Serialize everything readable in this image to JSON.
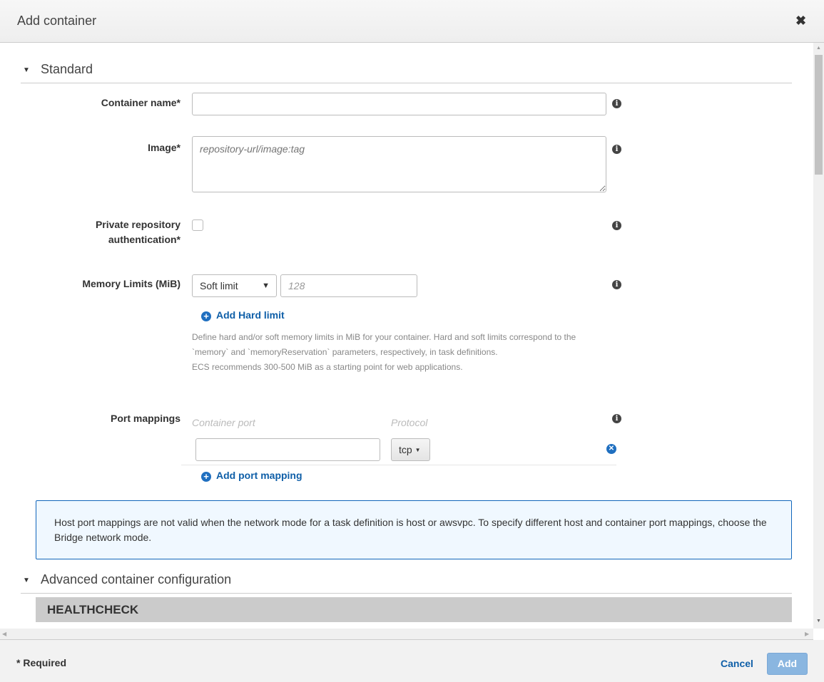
{
  "header": {
    "title": "Add container",
    "close_icon": "close-icon"
  },
  "standard": {
    "title": "Standard",
    "container_name": {
      "label": "Container name*",
      "value": ""
    },
    "image": {
      "label": "Image*",
      "placeholder": "repository-url/image:tag"
    },
    "private_repo": {
      "label_line1": "Private repository",
      "label_line2": "authentication*",
      "checked": false
    },
    "memory": {
      "label": "Memory Limits (MiB)",
      "limit_type": "Soft limit",
      "placeholder": "128",
      "add_hard_limit": "Add Hard limit",
      "help": [
        "Define hard and/or soft memory limits in MiB for your container. Hard and soft limits correspond to the",
        "`memory` and `memoryReservation` parameters, respectively, in task definitions.",
        "ECS recommends 300-500 MiB as a starting point for web applications."
      ]
    },
    "ports": {
      "label": "Port mappings",
      "col_container_port": "Container port",
      "col_protocol": "Protocol",
      "rows": [
        {
          "container_port": "",
          "protocol": "tcp"
        }
      ],
      "add_label": "Add port mapping"
    },
    "notice": "Host port mappings are not valid when the network mode for a task definition is host or awsvpc. To specify different host and container port mappings, choose the Bridge network mode."
  },
  "advanced": {
    "title": "Advanced container configuration",
    "healthcheck": "HEALTHCHECK"
  },
  "footer": {
    "required": "* Required",
    "cancel": "Cancel",
    "add": "Add"
  },
  "colors": {
    "link": "#0f5fa8",
    "add_button": "#8ab6e0",
    "notice_bg": "#f0f8ff",
    "notice_border": "#1166bb"
  }
}
